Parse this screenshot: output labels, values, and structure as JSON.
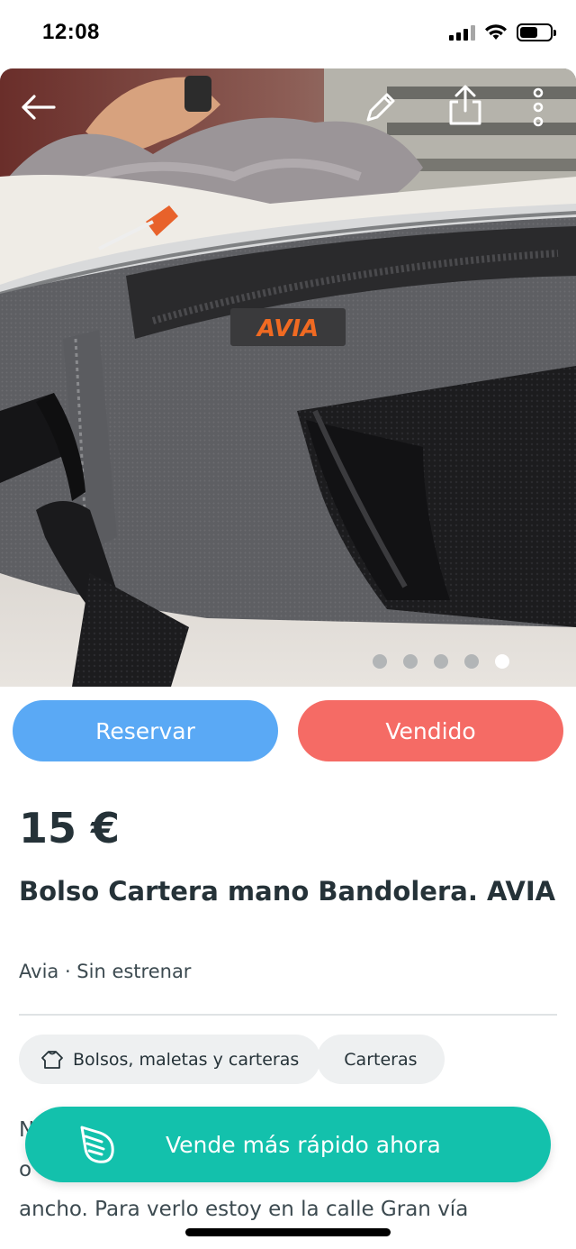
{
  "status_bar": {
    "time": "12:08",
    "battery_level": 0.6
  },
  "photo": {
    "brand_tag": "AVIA",
    "page_count": 5,
    "active_index": 4,
    "toolbar": {
      "back_icon": "arrow-left-icon",
      "edit_icon": "pencil-icon",
      "share_icon": "share-icon",
      "more_icon": "more-vertical-icon"
    }
  },
  "actions": {
    "reserve_label": "Reservar",
    "sold_label": "Vendido",
    "reserve_color": "#5aa9f5",
    "sold_color": "#f56b65"
  },
  "product": {
    "price": "15 €",
    "title": "Bolso Cartera mano Bandolera. AVIA",
    "meta": "Avia · Sin estrenar",
    "categories": [
      {
        "label": "Bolsos, maletas y carteras",
        "icon": "bag-category-icon"
      },
      {
        "label": "Carteras"
      }
    ],
    "description_visible": [
      "N",
      "o",
      "ancho. Para verlo estoy en la calle Gran vía"
    ]
  },
  "promo": {
    "label": "Vende más rápido ahora",
    "icon": "wing-icon",
    "color": "#13c1ac"
  }
}
